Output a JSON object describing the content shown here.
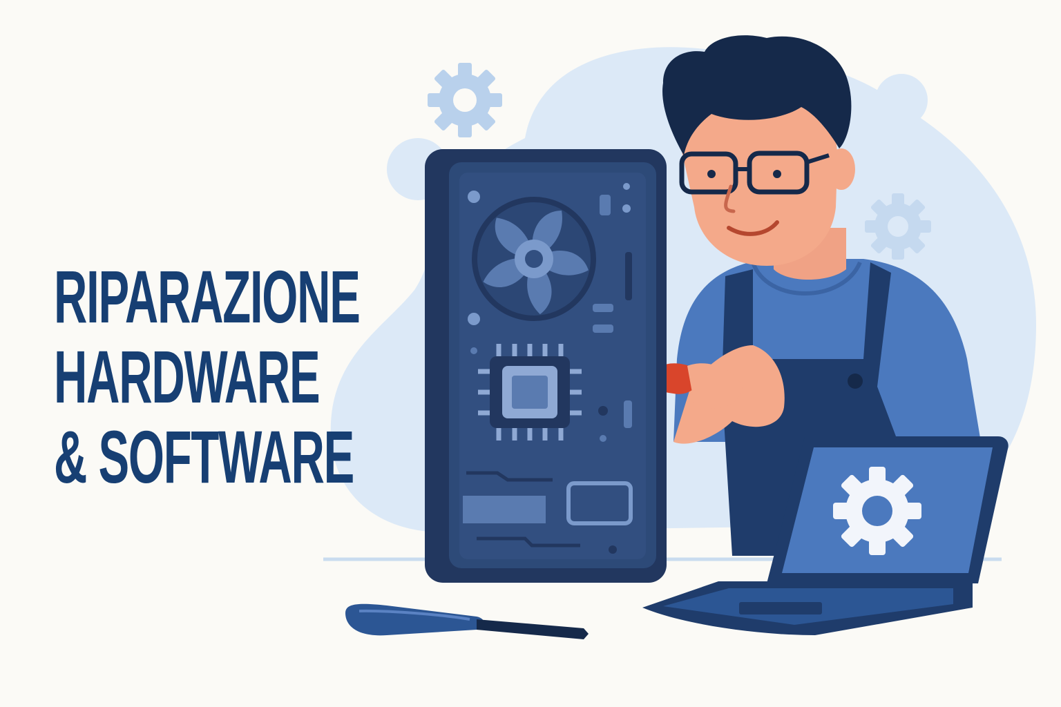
{
  "headline": {
    "line1": "RIPARAZIONE",
    "line2": "HARDWARE",
    "line3": "& SOFTWARE"
  },
  "icons": [
    "gear-icon",
    "fan-icon",
    "cpu-chip-icon",
    "screwdriver-icon",
    "laptop-icon"
  ],
  "colors": {
    "navy": "#173f73",
    "blue": "#4b79be",
    "light_blue": "#dce9f7",
    "tower": "#22375f",
    "accent_red": "#d9452b",
    "skin": "#f4a98a",
    "background": "#fbfaf6"
  }
}
